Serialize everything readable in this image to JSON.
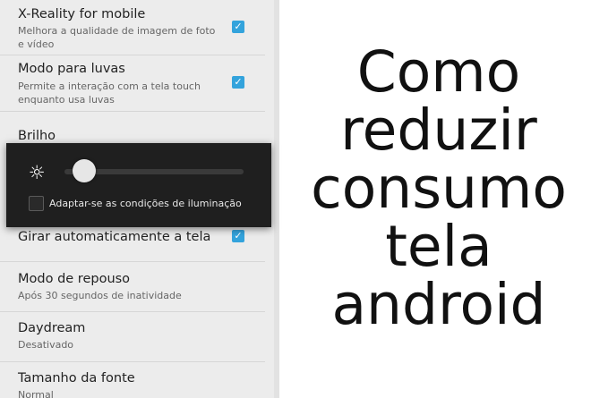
{
  "settings": {
    "xreality": {
      "title": "X-Reality for mobile",
      "subtitle": "Melhora a qualidade de imagem de foto e vídeo",
      "checked": true
    },
    "gloves": {
      "title": "Modo para luvas",
      "subtitle": "Permite a interação com a tela touch enquanto usa luvas",
      "checked": true
    },
    "brightness": {
      "title": "Brilho"
    },
    "rotate": {
      "title": "Girar automaticamente a tela",
      "checked": true
    },
    "sleep": {
      "title": "Modo de repouso",
      "subtitle": "Após 30 segundos de inatividade"
    },
    "daydream": {
      "title": "Daydream",
      "subtitle": "Desativado"
    },
    "fontsize": {
      "title": "Tamanho da fonte",
      "subtitle": "Normal"
    }
  },
  "brightness_dialog": {
    "icon": "sun-icon",
    "level": 0.05,
    "adaptive_label": "Adaptar-se as condições de iluminação",
    "adaptive_checked": false
  },
  "headline": {
    "line1": "Como",
    "line2": "reduzir",
    "line3": "consumo",
    "line4": "tela",
    "line5": "android"
  },
  "colors": {
    "checkbox_accent": "#33a3dc",
    "panel_bg": "#ececec",
    "dialog_bg": "#1f1f1f"
  }
}
